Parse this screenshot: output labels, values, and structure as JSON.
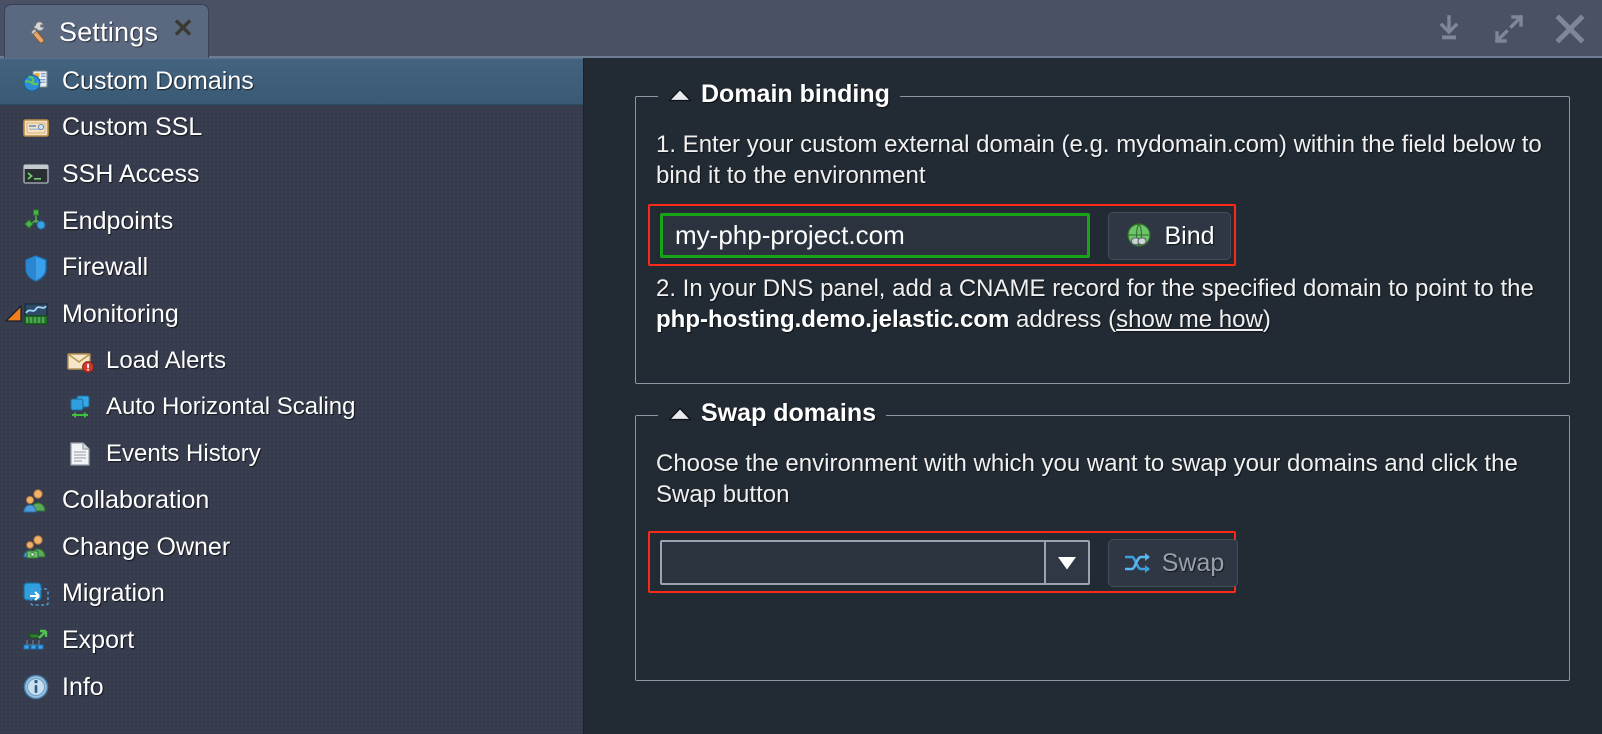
{
  "window": {
    "tab_label": "Settings",
    "tab_icon": "wrench-screwdriver-icon",
    "tab_close_glyph": "✕",
    "controls": [
      {
        "name": "minimize-button",
        "icon": "minimize-download-icon"
      },
      {
        "name": "maximize-button",
        "icon": "expand-diagonal-arrows-icon"
      },
      {
        "name": "close-button",
        "icon": "close-x-icon"
      }
    ]
  },
  "sidebar": {
    "items": [
      {
        "label": "Custom Domains",
        "icon": "globe-window-icon",
        "selected": true,
        "level": 0,
        "arrow": "none"
      },
      {
        "label": "Custom SSL",
        "icon": "certificate-icon",
        "selected": false,
        "level": 0,
        "arrow": "none"
      },
      {
        "label": "SSH Access",
        "icon": "terminal-icon",
        "selected": false,
        "level": 0,
        "arrow": "none"
      },
      {
        "label": "Endpoints",
        "icon": "endpoints-nodes-icon",
        "selected": false,
        "level": 0,
        "arrow": "none"
      },
      {
        "label": "Firewall",
        "icon": "shield-icon",
        "selected": false,
        "level": 0,
        "arrow": "none"
      },
      {
        "label": "Monitoring",
        "icon": "chart-basket-icon",
        "selected": false,
        "level": 0,
        "arrow": "expanded"
      },
      {
        "label": "Load Alerts",
        "icon": "envelope-alert-icon",
        "selected": false,
        "level": 1,
        "arrow": "none"
      },
      {
        "label": "Auto Horizontal Scaling",
        "icon": "scaling-nodes-icon",
        "selected": false,
        "level": 1,
        "arrow": "none"
      },
      {
        "label": "Events History",
        "icon": "document-icon",
        "selected": false,
        "level": 1,
        "arrow": "none"
      },
      {
        "label": "Collaboration",
        "icon": "users-group-icon",
        "selected": false,
        "level": 0,
        "arrow": "none"
      },
      {
        "label": "Change Owner",
        "icon": "user-money-icon",
        "selected": false,
        "level": 0,
        "arrow": "none"
      },
      {
        "label": "Migration",
        "icon": "migration-arrow-icon",
        "selected": false,
        "level": 0,
        "arrow": "none"
      },
      {
        "label": "Export",
        "icon": "export-upload-icon",
        "selected": false,
        "level": 0,
        "arrow": "none"
      },
      {
        "label": "Info",
        "icon": "info-circle-icon",
        "selected": false,
        "level": 0,
        "arrow": "none"
      }
    ]
  },
  "domain_binding": {
    "legend": "Domain binding",
    "collapse_icon": "triangle-up-icon",
    "step1": "1. Enter your custom external domain (e.g. mydomain.com) within the field below to bind it to the environment",
    "domain_input_value": "my-php-project.com",
    "domain_input_placeholder": "",
    "bind_button_label": "Bind",
    "bind_button_icon": "globe-link-icon",
    "step2_prefix": "2. In your DNS panel, add a CNAME record for the specified domain to point to the ",
    "step2_bold": "php-hosting.demo.jelastic.com",
    "step2_middle": " address (",
    "step2_link": "show me how",
    "step2_suffix": ")"
  },
  "swap_domains": {
    "legend": "Swap domains",
    "collapse_icon": "triangle-up-icon",
    "description": "Choose the environment with which you want to swap your domains and click the Swap button",
    "environment_select_value": "",
    "environment_select_arrow_icon": "chevron-down-icon",
    "swap_button_label": "Swap",
    "swap_button_icon": "swap-arrows-icon",
    "swap_button_disabled": true
  },
  "annotations": {
    "highlight_color": "#fb2a18",
    "focus_color": "#18a318"
  }
}
